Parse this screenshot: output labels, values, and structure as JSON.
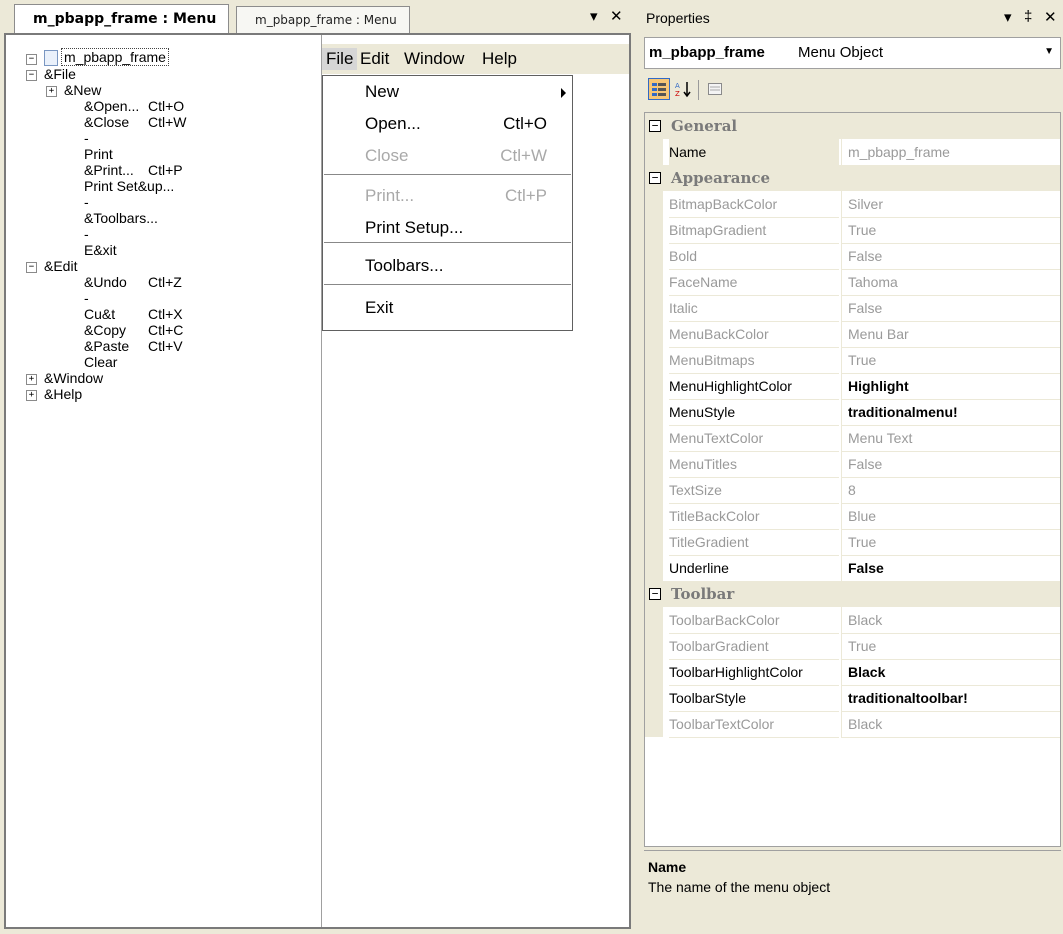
{
  "left_tabs": {
    "active": "m_pbapp_frame : Menu",
    "inactive": "m_pbapp_frame : Menu",
    "dropdown_glyph": "▾",
    "close_glyph": "✕"
  },
  "tree": {
    "root": "m_pbapp_frame",
    "rows": [
      {
        "label": "&File",
        "shortcut": "",
        "expander": "−"
      },
      {
        "label": "&New",
        "shortcut": "",
        "expander": "+"
      },
      {
        "label": "&Open...",
        "shortcut": "Ctl+O",
        "expander": ""
      },
      {
        "label": "&Close",
        "shortcut": "Ctl+W",
        "expander": ""
      },
      {
        "label": "-",
        "shortcut": "",
        "expander": ""
      },
      {
        "label": "Print",
        "shortcut": "",
        "expander": ""
      },
      {
        "label": "&Print...",
        "shortcut": "Ctl+P",
        "expander": ""
      },
      {
        "label": "Print Set&up...",
        "shortcut": "",
        "expander": ""
      },
      {
        "label": "-",
        "shortcut": "",
        "expander": ""
      },
      {
        "label": "&Toolbars...",
        "shortcut": "",
        "expander": ""
      },
      {
        "label": "-",
        "shortcut": "",
        "expander": ""
      },
      {
        "label": "E&xit",
        "shortcut": "",
        "expander": ""
      },
      {
        "label": "&Edit",
        "shortcut": "",
        "expander": "−"
      },
      {
        "label": "&Undo",
        "shortcut": "Ctl+Z",
        "expander": ""
      },
      {
        "label": "-",
        "shortcut": "",
        "expander": ""
      },
      {
        "label": "Cu&t",
        "shortcut": "Ctl+X",
        "expander": ""
      },
      {
        "label": "&Copy",
        "shortcut": "Ctl+C",
        "expander": ""
      },
      {
        "label": "&Paste",
        "shortcut": "Ctl+V",
        "expander": ""
      },
      {
        "label": "Clear",
        "shortcut": "",
        "expander": ""
      },
      {
        "label": "&Window",
        "shortcut": "",
        "expander": "+"
      },
      {
        "label": "&Help",
        "shortcut": "",
        "expander": "+"
      }
    ]
  },
  "preview_menubar": [
    "File",
    "Edit",
    "Window",
    "Help"
  ],
  "preview_dropdown": [
    {
      "label": "New",
      "shortcut": "",
      "disabled": false
    },
    {
      "label": "Open...",
      "shortcut": "Ctl+O",
      "disabled": false
    },
    {
      "label": "Close",
      "shortcut": "Ctl+W",
      "disabled": true
    },
    {
      "label": "Print...",
      "shortcut": "Ctl+P",
      "disabled": true
    },
    {
      "label": "Print Setup...",
      "shortcut": "",
      "disabled": false
    },
    {
      "label": "Toolbars...",
      "shortcut": "",
      "disabled": false
    },
    {
      "label": "Exit",
      "shortcut": "",
      "disabled": false
    }
  ],
  "properties": {
    "title": "Properties",
    "pin_glyph": "‡",
    "object_name": "m_pbapp_frame",
    "object_type": "Menu Object",
    "categories": [
      {
        "name": "General",
        "rows": [
          {
            "name": "Name",
            "value": "m_pbapp_frame",
            "modified": false,
            "selected": true
          }
        ]
      },
      {
        "name": "Appearance",
        "rows": [
          {
            "name": "BitmapBackColor",
            "value": "Silver",
            "modified": false
          },
          {
            "name": "BitmapGradient",
            "value": "True",
            "modified": false
          },
          {
            "name": "Bold",
            "value": "False",
            "modified": false
          },
          {
            "name": "FaceName",
            "value": "Tahoma",
            "modified": false
          },
          {
            "name": "Italic",
            "value": "False",
            "modified": false
          },
          {
            "name": "MenuBackColor",
            "value": "Menu Bar",
            "modified": false
          },
          {
            "name": "MenuBitmaps",
            "value": "True",
            "modified": false
          },
          {
            "name": "MenuHighlightColor",
            "value": "Highlight",
            "modified": true
          },
          {
            "name": "MenuStyle",
            "value": "traditionalmenu!",
            "modified": true
          },
          {
            "name": "MenuTextColor",
            "value": "Menu Text",
            "modified": false
          },
          {
            "name": "MenuTitles",
            "value": "False",
            "modified": false
          },
          {
            "name": "TextSize",
            "value": "8",
            "modified": false
          },
          {
            "name": "TitleBackColor",
            "value": "Blue",
            "modified": false
          },
          {
            "name": "TitleGradient",
            "value": "True",
            "modified": false
          },
          {
            "name": "Underline",
            "value": "False",
            "modified": true
          }
        ]
      },
      {
        "name": "Toolbar",
        "rows": [
          {
            "name": "ToolbarBackColor",
            "value": "Black",
            "modified": false
          },
          {
            "name": "ToolbarGradient",
            "value": "True",
            "modified": false
          },
          {
            "name": "ToolbarHighlightColor",
            "value": "Black",
            "modified": true
          },
          {
            "name": "ToolbarStyle",
            "value": "traditionaltoolbar!",
            "modified": true
          },
          {
            "name": "ToolbarTextColor",
            "value": "Black",
            "modified": false
          }
        ]
      }
    ],
    "description_title": "Name",
    "description_text": "The name of the menu object"
  },
  "colors": {
    "panel": "#ece9d8",
    "selection": "#f6c676",
    "border": "#7a7a7a"
  }
}
